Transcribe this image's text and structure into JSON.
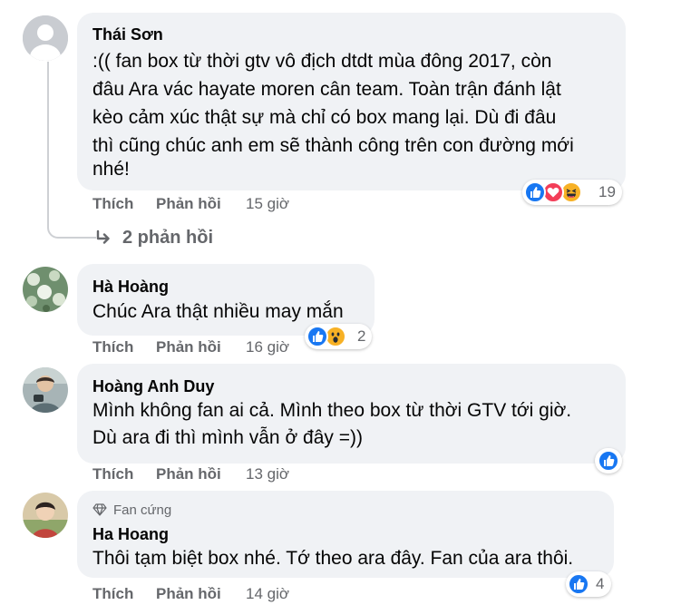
{
  "comments": [
    {
      "author": "Thái Sơn",
      "lines": [
        ":(( fan box từ thời gtv vô địch dtdt mùa đông 2017, còn",
        "đâu Ara vác hayate moren cân team. Toàn trận đánh lật",
        "kèo cảm xúc thật sự mà chỉ có box mang lại. Dù đi đâu",
        "thì cũng chúc anh em sẽ thành công trên con đường mới",
        "nhé!"
      ],
      "like_label": "Thích",
      "reply_label": "Phản hồi",
      "time": "15 giờ",
      "reactions": [
        "like-icon",
        "love-icon",
        "haha-icon"
      ],
      "reaction_count": "19",
      "replies_link": "2 phản hồi"
    },
    {
      "author": "Hà Hoàng",
      "lines": [
        "Chúc Ara thật nhiều may mắn"
      ],
      "like_label": "Thích",
      "reply_label": "Phản hồi",
      "time": "16 giờ",
      "reactions": [
        "like-icon",
        "wow-icon"
      ],
      "reaction_count": "2"
    },
    {
      "author": "Hoàng Anh Duy",
      "lines": [
        "Mình không fan ai cả. Mình theo box từ thời GTV tới giờ.",
        "Dù ara đi thì mình vẫn ở đây =))"
      ],
      "like_label": "Thích",
      "reply_label": "Phản hồi",
      "time": "13 giờ",
      "reactions": [
        "like-icon"
      ],
      "reaction_count": ""
    },
    {
      "badge": "Fan cứng",
      "author": "Ha Hoang",
      "lines": [
        "Thôi tạm biệt box nhé. Tớ theo ara đây. Fan của ara thôi."
      ],
      "like_label": "Thích",
      "reply_label": "Phản hồi",
      "time": "14 giờ",
      "reactions": [
        "like-icon"
      ],
      "reaction_count": "4"
    }
  ],
  "colors": {
    "bubble": "#f0f2f5",
    "secondary_text": "#65676b",
    "like_blue": "#1877f2",
    "love_red": "#f33e58",
    "reaction_yellow": "#f7b125"
  }
}
